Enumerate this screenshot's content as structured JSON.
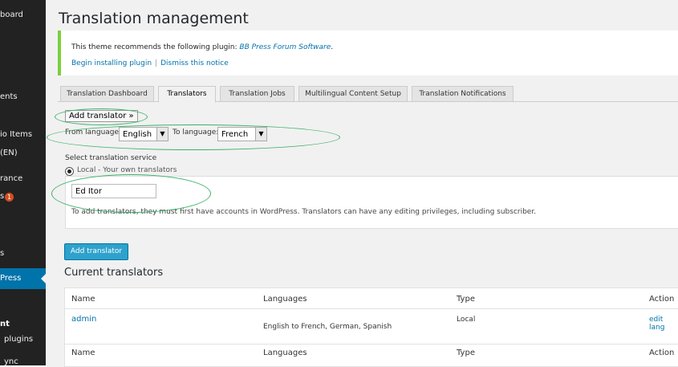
{
  "sidebar": {
    "items": [
      {
        "label": "board"
      },
      {
        "label": "ents"
      },
      {
        "label": "io Items"
      },
      {
        "label": "(EN)"
      },
      {
        "label": "rance"
      },
      {
        "label": "s"
      },
      {
        "label": "s"
      },
      {
        "label": "Press"
      },
      {
        "label": "nt"
      },
      {
        "label": "plugins"
      },
      {
        "label": "ync"
      }
    ],
    "badge_count": "1"
  },
  "page": {
    "title": "Translation management"
  },
  "notice": {
    "text": "This theme recommends the following plugin: ",
    "plugin": "BB Press Forum Software",
    "period": ".",
    "install_link": "Begin installing plugin",
    "separator": "|",
    "dismiss_link": "Dismiss this notice",
    "accent_color": "#7ad03a"
  },
  "tabs": [
    {
      "label": "Translation Dashboard"
    },
    {
      "label": "Translators"
    },
    {
      "label": "Translation Jobs"
    },
    {
      "label": "Multilingual Content Setup"
    },
    {
      "label": "Translation Notifications"
    }
  ],
  "form": {
    "add_translator_link": "Add translator »",
    "from_label": "From language:",
    "from_value": "English",
    "to_label": "To language:",
    "to_value": "French",
    "service_label": "Select translation service",
    "service_option": "Local - Your own translators",
    "user_value": "Ed Itor",
    "note": "To add translators, they must first have accounts in WordPress. Translators can have any editing privileges, including subscriber.",
    "submit_label": "Add translator"
  },
  "current": {
    "title": "Current translators",
    "columns": [
      "Name",
      "Languages",
      "Type",
      "Action"
    ],
    "rows": [
      {
        "name": "admin",
        "languages": "English to French, German, Spanish",
        "type": "Local",
        "action": "edit lang"
      }
    ]
  },
  "colors": {
    "primary_button": "#2ea2cc",
    "active_menu": "#0073aa",
    "annotation": "#3bb26a"
  }
}
